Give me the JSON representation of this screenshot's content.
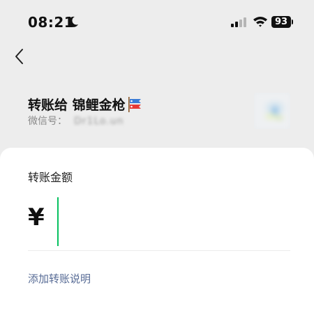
{
  "status_bar": {
    "time": "08:21",
    "battery": "93",
    "moon_icon": "moon-icon",
    "signal_icon": "cellular-signal-icon",
    "wifi_icon": "wifi-icon"
  },
  "nav": {
    "back_icon": "chevron-left-icon"
  },
  "recipient": {
    "title": "转账给 锦鲤金枪",
    "emoji_icon": "koinobori-icon",
    "wechat_id_label": "微信号：",
    "wechat_id_value": "Dr1Lo.un"
  },
  "amount": {
    "label": "转账金额",
    "currency_symbol": "¥",
    "value": ""
  },
  "note_link": "添加转账说明",
  "colors": {
    "accent_green": "#07c160",
    "link_blue": "#576b95",
    "background_gray": "#ededed"
  }
}
